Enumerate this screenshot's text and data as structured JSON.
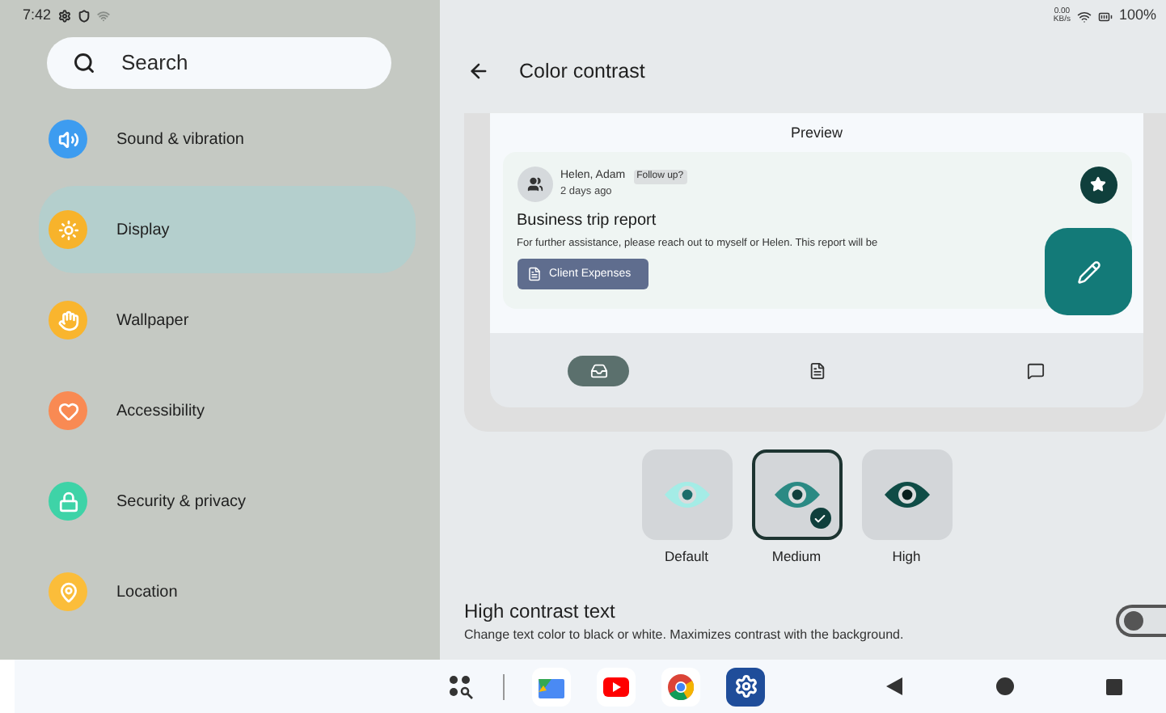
{
  "status_bar": {
    "time": "7:42",
    "network_speed": "0.00",
    "network_unit": "KB/s",
    "battery": "100%"
  },
  "search": {
    "placeholder": "Search"
  },
  "sidebar": {
    "items": [
      {
        "label": "Sound & vibration",
        "selected": false,
        "color": "#3d9cf0"
      },
      {
        "label": "Display",
        "selected": true,
        "color": "#f7b32b"
      },
      {
        "label": "Wallpaper",
        "selected": false,
        "color": "#f9b52e"
      },
      {
        "label": "Accessibility",
        "selected": false,
        "color": "#f98a53"
      },
      {
        "label": "Security & privacy",
        "selected": false,
        "color": "#3ed3a7"
      },
      {
        "label": "Location",
        "selected": false,
        "color": "#fbbd3a"
      }
    ]
  },
  "header": {
    "title": "Color contrast"
  },
  "preview": {
    "title": "Preview",
    "email": {
      "sender": "Helen, Adam",
      "tag": "Follow up?",
      "time": "2 days ago",
      "subject": "Business trip report",
      "body": "For further assistance, please reach out to myself or Helen. This report will be",
      "attachment": "Client Expenses"
    },
    "nav_items": [
      {
        "selected": true
      },
      {
        "selected": false
      },
      {
        "selected": false
      }
    ]
  },
  "contrast_options": [
    {
      "label": "Default",
      "selected": false
    },
    {
      "label": "Medium",
      "selected": true
    },
    {
      "label": "High",
      "selected": false
    }
  ],
  "high_contrast_text": {
    "title": "High contrast text",
    "description": "Change text color to black or white. Maximizes contrast with the background.",
    "on": false
  }
}
